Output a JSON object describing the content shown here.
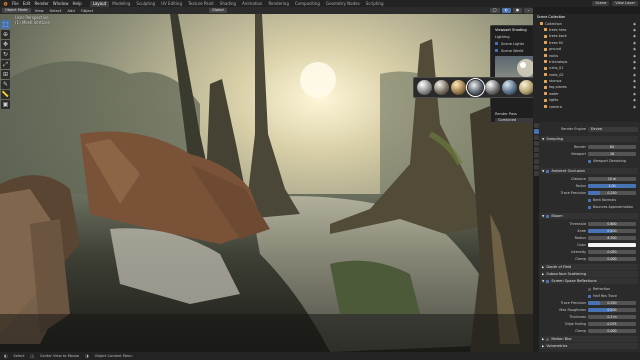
{
  "menu": [
    "File",
    "Edit",
    "Render",
    "Window",
    "Help"
  ],
  "workspaces": [
    {
      "label": "Layout",
      "active": true
    },
    {
      "label": "Modeling",
      "active": false
    },
    {
      "label": "Sculpting",
      "active": false
    },
    {
      "label": "UV Editing",
      "active": false
    },
    {
      "label": "Texture Paint",
      "active": false
    },
    {
      "label": "Shading",
      "active": false
    },
    {
      "label": "Animation",
      "active": false
    },
    {
      "label": "Rendering",
      "active": false
    },
    {
      "label": "Compositing",
      "active": false
    },
    {
      "label": "Geometry Nodes",
      "active": false
    },
    {
      "label": "Scripting",
      "active": false
    }
  ],
  "topright": {
    "scene": "Scene",
    "view_layer": "View Layer"
  },
  "header2": {
    "mode": "Object Mode",
    "view": "View",
    "select": "Select",
    "add": "Add",
    "object": "Object",
    "orientation": "Global"
  },
  "viewport": {
    "line1": "User Perspective",
    "line2": "(1) Mesh.Vertices"
  },
  "shading_popover": {
    "title": "Viewport Shading",
    "lighting": "Lighting",
    "scene_lights": "Scene Lights",
    "scene_world": "Scene World",
    "render_pass": "Render Pass",
    "render_pass_value": "Combined"
  },
  "outliner": {
    "header": "Scene Collection",
    "items": [
      "Collection",
      "trees hero",
      "trees back",
      "trees fill",
      "ground",
      "rocks",
      "triceratops",
      "ruins_01",
      "roots_02",
      "stumps",
      "fog planes",
      "water",
      "lights",
      "camera"
    ]
  },
  "properties": {
    "render_engine_label": "Render Engine",
    "render_engine": "Eevee",
    "sampling": "Sampling",
    "render_label": "Render",
    "render_value": "64",
    "viewport_label": "Viewport",
    "viewport_value": "16",
    "viewport_denoising": "Viewport Denoising",
    "ao": "Ambient Occlusion",
    "ao_distance_label": "Distance",
    "ao_distance": "10 m",
    "ao_factor_label": "Factor",
    "ao_factor": "1.00",
    "ao_precision_label": "Trace Precision",
    "ao_precision": "0.250",
    "bent_normals": "Bent Normals",
    "bounces_approx": "Bounces Approximation",
    "bloom": "Bloom",
    "bloom_threshold_label": "Threshold",
    "bloom_threshold": "0.800",
    "bloom_knee_label": "Knee",
    "bloom_knee": "0.500",
    "bloom_radius_label": "Radius",
    "bloom_radius": "6.500",
    "bloom_color_label": "Color",
    "bloom_intensity_label": "Intensity",
    "bloom_intensity": "0.050",
    "bloom_clamp_label": "Clamp",
    "bloom_clamp": "0.000",
    "dof": "Depth of Field",
    "sss": "Subsurface Scattering",
    "ssr": "Screen Space Reflections",
    "refraction": "Refraction",
    "half_res": "Half Res Trace",
    "ssr_precision_label": "Trace Precision",
    "ssr_precision": "0.250",
    "ssr_roughness_label": "Max Roughness",
    "ssr_roughness": "0.500",
    "ssr_thickness_label": "Thickness",
    "ssr_thickness": "0.2 m",
    "ssr_fade_label": "Edge Fading",
    "ssr_fade": "0.075",
    "ssr_clamp_label": "Clamp",
    "ssr_clamp": "0.000",
    "motion_blur": "Motion Blur",
    "volumetrics": "Volumetrics",
    "performance": "Performance",
    "hair": "Hair"
  },
  "statusbar": {
    "select": "Select",
    "center": "Center View to Mouse",
    "object": "Object Context Menu"
  },
  "colors": {
    "accent": "#4772b3",
    "panel": "#2b2b2b",
    "header": "#232323"
  }
}
